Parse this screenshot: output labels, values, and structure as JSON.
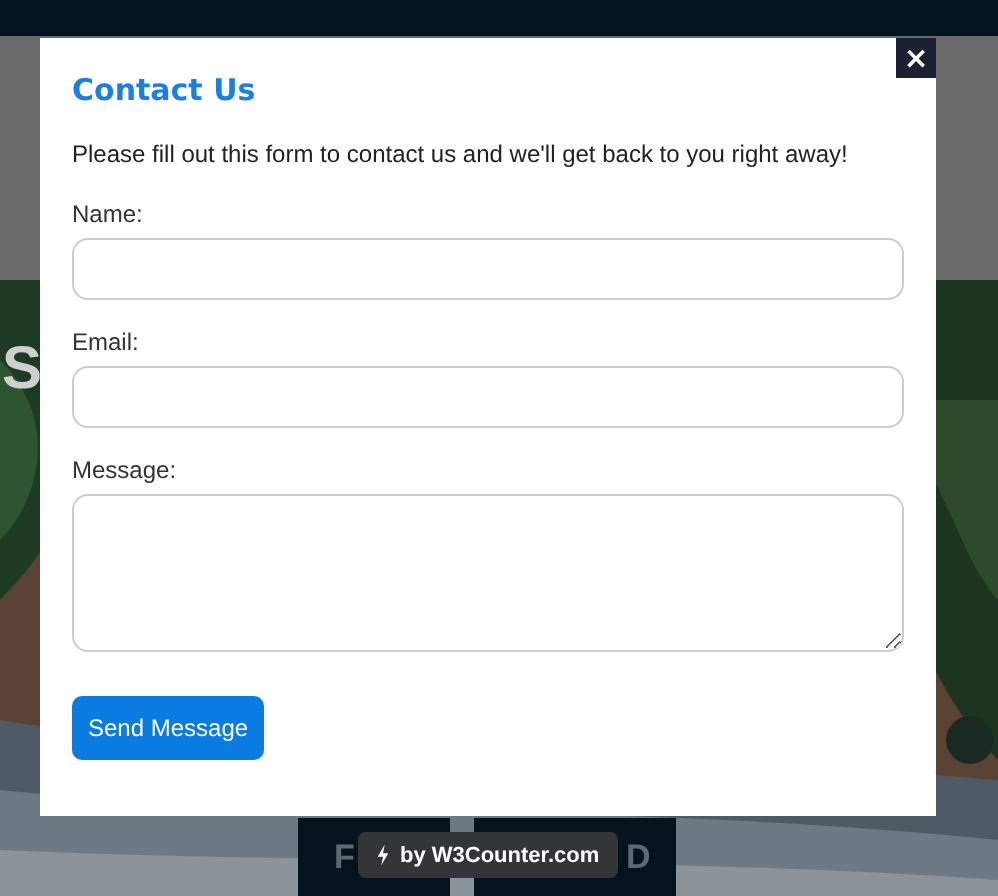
{
  "background": {
    "heading_fragment": "S",
    "buttons": [
      {
        "label": "F"
      },
      {
        "label": "D"
      }
    ]
  },
  "modal": {
    "title": "Contact Us",
    "close": "×",
    "intro": "Please fill out this form to contact us and we'll get back to you right away!",
    "fields": [
      {
        "kind": "input",
        "label": "Name:"
      },
      {
        "kind": "input",
        "label": "Email:"
      },
      {
        "kind": "textarea",
        "label": "Message:"
      }
    ],
    "submit": "Send Message"
  },
  "badge": {
    "text": "by W3Counter.com"
  }
}
